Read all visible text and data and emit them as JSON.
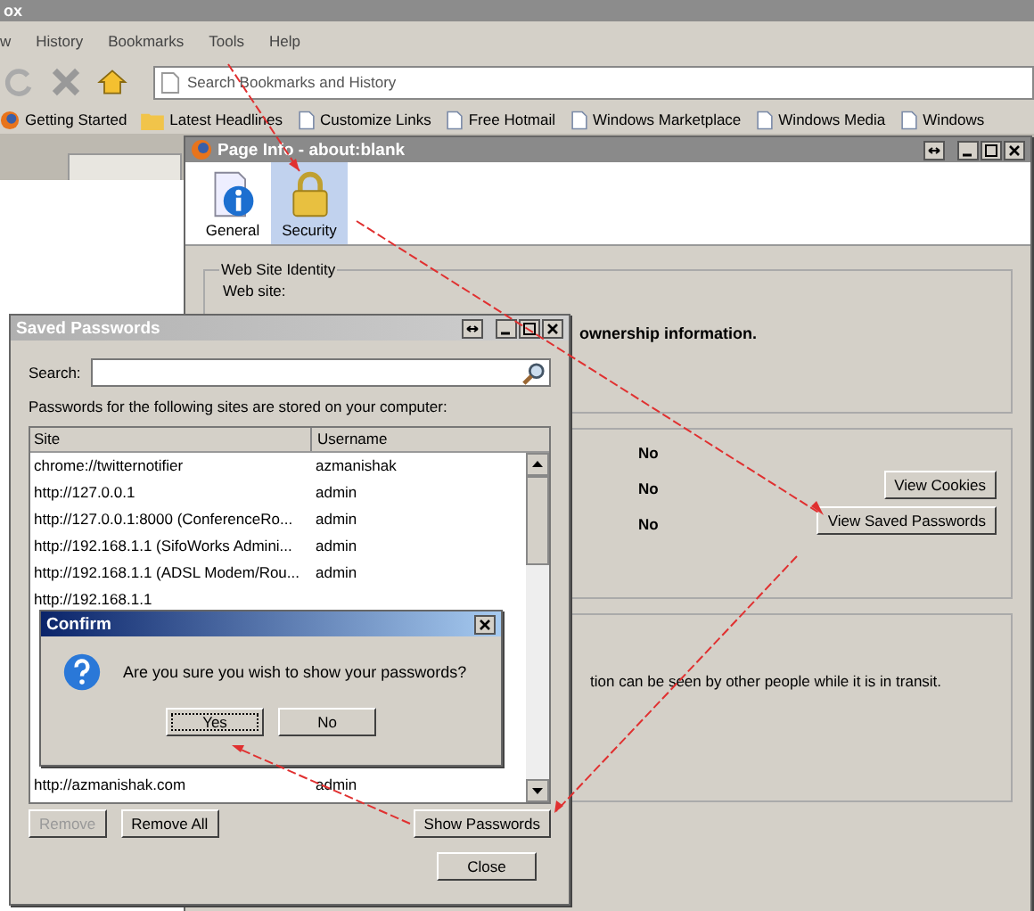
{
  "browser": {
    "title": "ox",
    "menu": [
      {
        "label": "w"
      },
      {
        "label": "History"
      },
      {
        "label": "Bookmarks"
      },
      {
        "label": "Tools"
      },
      {
        "label": "Help"
      }
    ],
    "address": {
      "placeholder": "Search Bookmarks and History"
    },
    "bookmarks": [
      {
        "label": "Getting Started",
        "kind": "fox"
      },
      {
        "label": "Latest Headlines",
        "kind": "feed"
      },
      {
        "label": "Customize Links",
        "kind": "page"
      },
      {
        "label": "Free Hotmail",
        "kind": "page"
      },
      {
        "label": "Windows Marketplace",
        "kind": "page"
      },
      {
        "label": "Windows Media",
        "kind": "page"
      },
      {
        "label": "Windows",
        "kind": "page"
      }
    ]
  },
  "page_info": {
    "title": "Page Info - about:blank",
    "tabs": [
      {
        "label": "General",
        "kind": "info",
        "selected": false
      },
      {
        "label": "Security",
        "kind": "lock",
        "selected": true
      }
    ],
    "identity": {
      "legend": "Web Site Identity",
      "label": "Web site:",
      "ownership": "ownership information."
    },
    "privacy_values": [
      "No",
      "No",
      "No"
    ],
    "buttons": [
      "View Cookies",
      "View Saved Passwords"
    ],
    "technical_text": "tion can be seen by other people while it is in transit."
  },
  "saved_passwords": {
    "title": "Saved Passwords",
    "search_label": "Search:",
    "intro": "Passwords for the following sites are stored on your computer:",
    "columns": [
      "Site",
      "Username"
    ],
    "rows": [
      {
        "site": "chrome://twitternotifier",
        "user": "azmanishak"
      },
      {
        "site": "http://127.0.0.1",
        "user": "admin"
      },
      {
        "site": "http://127.0.0.1:8000 (ConferenceRo...",
        "user": "admin"
      },
      {
        "site": "http://192.168.1.1 (SifoWorks Admini...",
        "user": "admin"
      },
      {
        "site": "http://192.168.1.1 (ADSL Modem/Rou...",
        "user": "admin"
      },
      {
        "site": "http://192.168.1.1",
        "user": ""
      }
    ],
    "last_row": {
      "site": "http://azmanishak.com",
      "user": "admin"
    },
    "buttons": [
      {
        "label": "Remove",
        "disabled": true
      },
      {
        "label": "Remove All",
        "disabled": false
      }
    ],
    "show_button": "Show Passwords",
    "close_button": "Close"
  },
  "confirm": {
    "title": "Confirm",
    "message": "Are you sure you wish to show your passwords?",
    "buttons": [
      {
        "label": "Yes",
        "selected": true
      },
      {
        "label": "No",
        "selected": false
      }
    ]
  }
}
